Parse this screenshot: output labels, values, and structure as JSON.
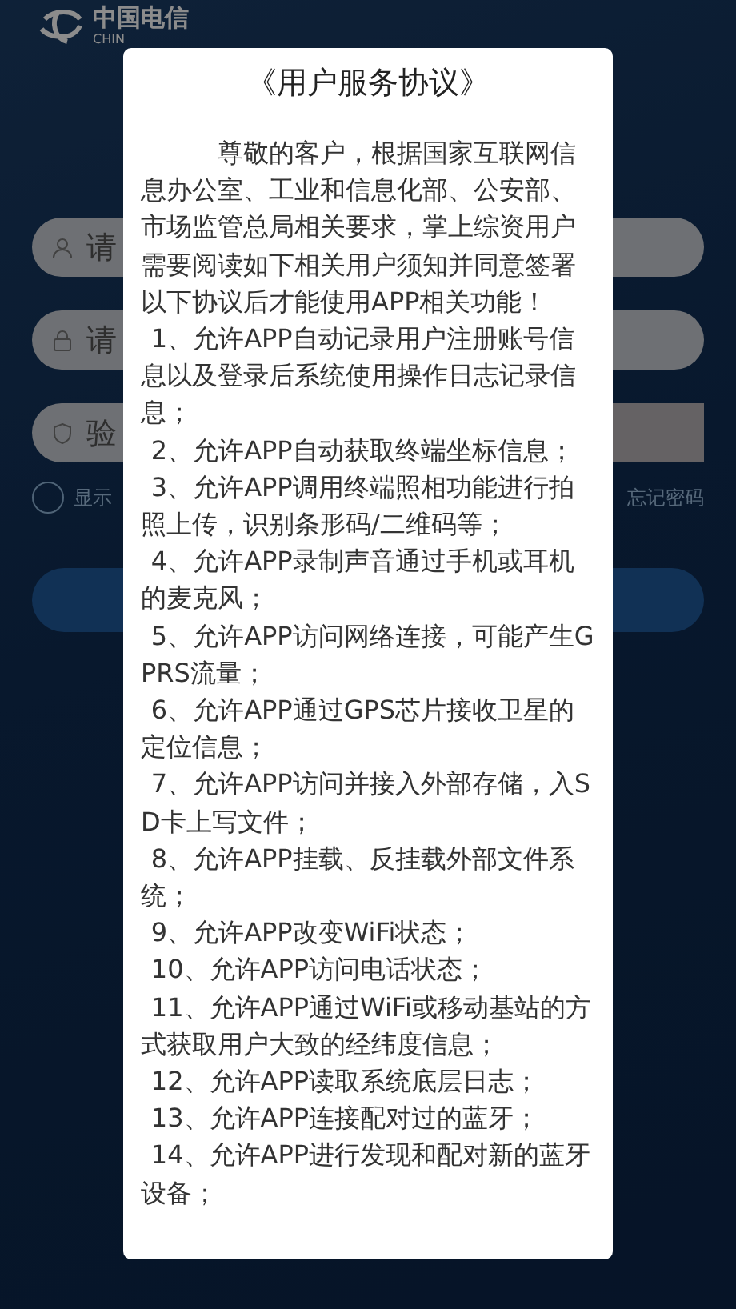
{
  "login": {
    "logo_text": "中国电信",
    "logo_subtext": "CHIN",
    "fields": [
      {
        "kind": "text",
        "placeholder": "请"
      },
      {
        "kind": "password",
        "placeholder": "请"
      },
      {
        "kind": "captcha",
        "placeholder": "验"
      }
    ],
    "show_password": {
      "label": "显示",
      "checked": false
    },
    "forgot_link": "忘记密码"
  },
  "dialog": {
    "title": "《用户服务协议》",
    "intro": "尊敬的客户，根据国家互联网信息办公室、工业和信息化部、公安部、市场监管总局相关要求，掌上综资用户需要阅读如下相关用户须知并同意签署以下协议后才能使用APP相关功能！",
    "items": [
      "1、允许APP自动记录用户注册账号信息以及登录后系统使用操作日志记录信息；",
      "2、允许APP自动获取终端坐标信息；",
      "3、允许APP调用终端照相功能进行拍照上传，识别条形码/二维码等；",
      "4、允许APP录制声音通过手机或耳机的麦克风；",
      "5、允许APP访问网络连接，可能产生GPRS流量；",
      "6、允许APP通过GPS芯片接收卫星的定位信息；",
      "7、允许APP访问并接入外部存储，入SD卡上写文件；",
      "8、允许APP挂载、反挂载外部文件系统；",
      "9、允许APP改变WiFi状态；",
      "10、允许APP访问电话状态；",
      "11、允许APP通过WiFi或移动基站的方式获取用户大致的经纬度信息；",
      "12、允许APP读取系统底层日志；",
      "13、允许APP连接配对过的蓝牙；",
      "14、允许APP进行发现和配对新的蓝牙设备；"
    ]
  }
}
